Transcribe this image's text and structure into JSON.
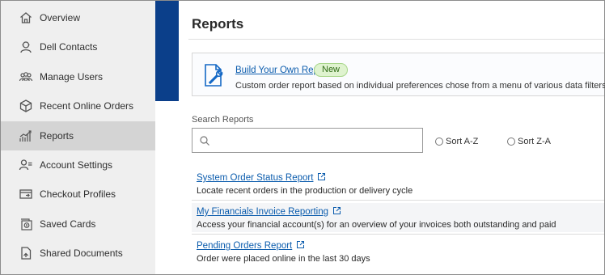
{
  "sidebar": {
    "items": [
      {
        "label": "Overview",
        "icon": "home-icon"
      },
      {
        "label": "Dell Contacts",
        "icon": "contact-icon"
      },
      {
        "label": "Manage Users",
        "icon": "users-icon"
      },
      {
        "label": "Recent Online Orders",
        "icon": "box-icon"
      },
      {
        "label": "Reports",
        "icon": "chart-icon",
        "active": true
      },
      {
        "label": "Account Settings",
        "icon": "user-settings-icon"
      },
      {
        "label": "Checkout Profiles",
        "icon": "checkout-icon"
      },
      {
        "label": "Saved Cards",
        "icon": "saved-card-icon"
      },
      {
        "label": "Shared Documents",
        "icon": "document-icon"
      }
    ]
  },
  "main": {
    "title": "Reports",
    "promo": {
      "link": "Build Your Own Report",
      "badge": "New",
      "description": "Custom order report based on individual preferences chose from a menu of various data filters"
    },
    "search": {
      "label": "Search Reports",
      "value": "",
      "placeholder": ""
    },
    "sort_options": [
      "Sort A-Z",
      "Sort Z-A"
    ],
    "reports": [
      {
        "title": "System Order Status Report",
        "description": "Locate recent orders in the production or delivery cycle"
      },
      {
        "title": "My Financials Invoice Reporting",
        "description": "Access your financial account(s) for an overview of your invoices both outstanding and paid"
      },
      {
        "title": "Pending Orders Report",
        "description": "Order were placed online in the last 30 days"
      }
    ]
  },
  "colors": {
    "accent_blue": "#0b3f8a",
    "link": "#0b5cad",
    "badge_bg": "#dff3cf"
  }
}
